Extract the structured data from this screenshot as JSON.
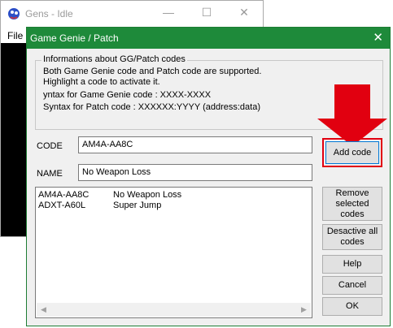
{
  "gens_window": {
    "title": "Gens - Idle",
    "menu_file": "File",
    "minimize_glyph": "—",
    "maximize_glyph": "☐",
    "close_glyph": "✕"
  },
  "dialog": {
    "title": "Game Genie / Patch",
    "close_glyph": "✕",
    "info_group": {
      "legend": "Informations about GG/Patch codes",
      "line1": "Both Game Genie code and Patch code are supported.",
      "line2": "Highlight a code to activate it.",
      "line3": "yntax for Game Genie code :  XXXX-XXXX",
      "line4": "Syntax for Patch code :  XXXXXX:YYYY    (address:data)"
    },
    "code_label": "CODE",
    "code_value": "AM4A-AA8C",
    "name_label": "NAME",
    "name_value": "No Weapon Loss",
    "buttons": {
      "add_code": "Add code",
      "remove_selected": "Remove selected codes",
      "deactivate_all": "Desactive all codes",
      "help": "Help",
      "cancel": "Cancel",
      "ok": "OK"
    },
    "codes_list": [
      {
        "code": "AM4A-AA8C",
        "name": "No Weapon Loss"
      },
      {
        "code": "ADXT-A60L",
        "name": "Super Jump"
      }
    ],
    "scroll_left_glyph": "◀",
    "scroll_right_glyph": "▶"
  },
  "annotation": {
    "arrow_color": "#e10010",
    "highlight_color": "#e10010"
  }
}
